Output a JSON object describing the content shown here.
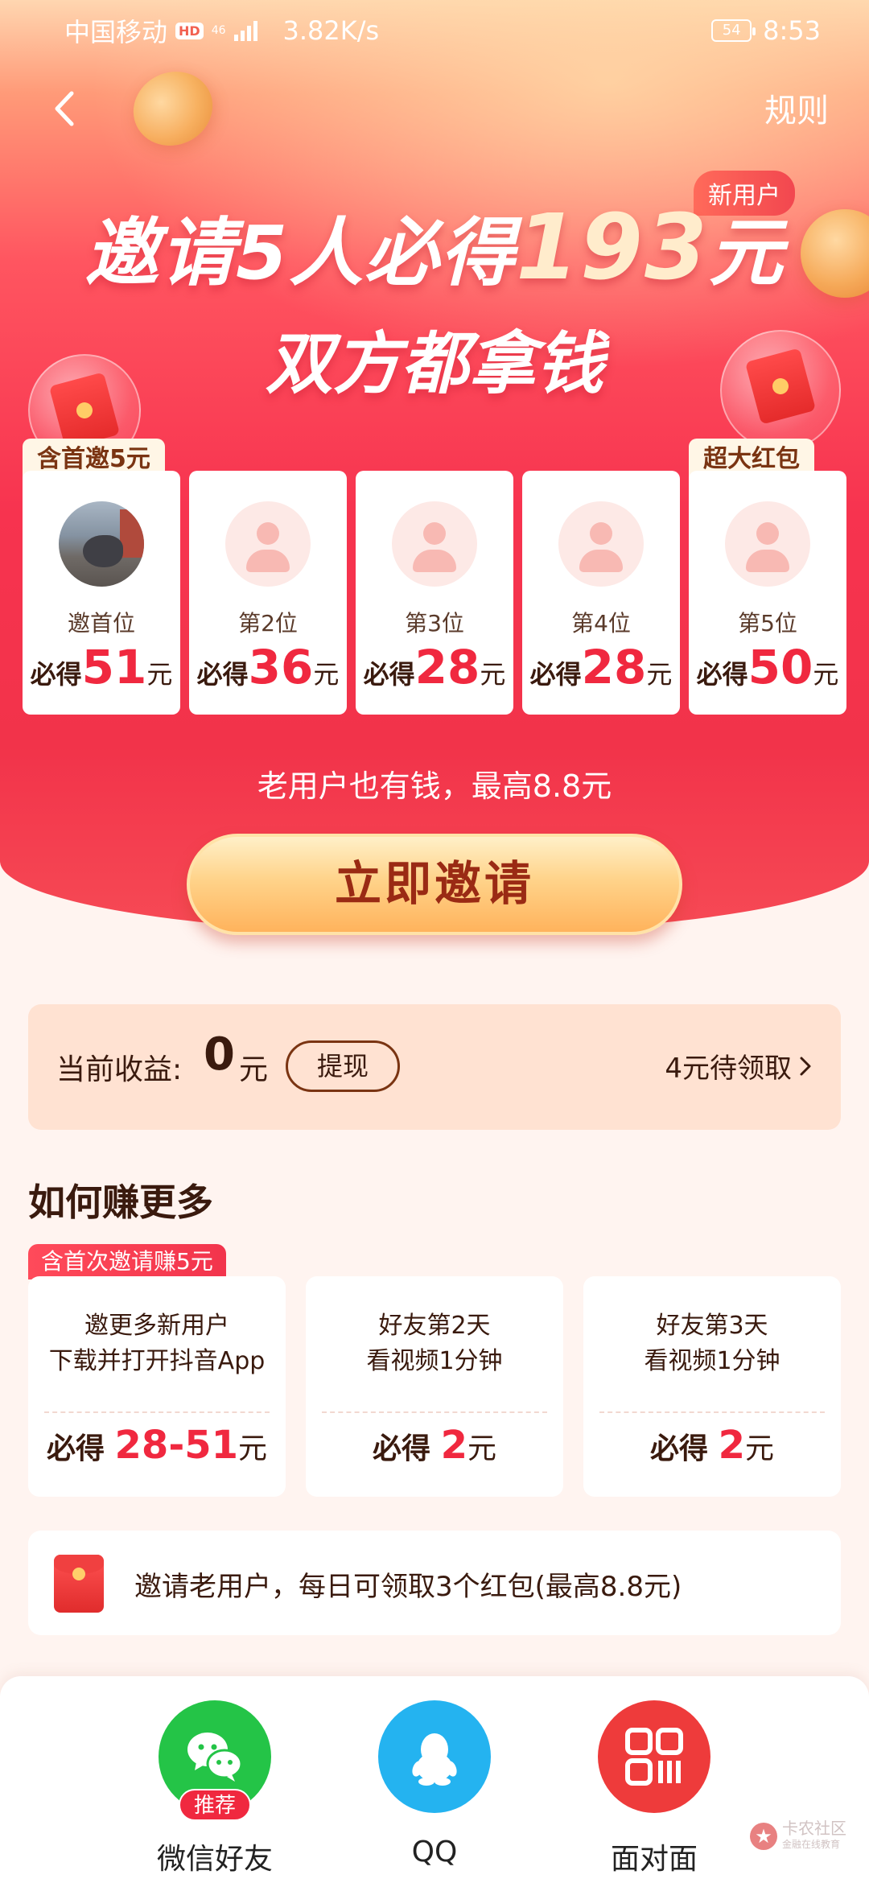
{
  "status_bar": {
    "carrier": "中国移动",
    "hd": "HD",
    "network": "46",
    "speed": "3.82K/s",
    "battery": "54",
    "time": "8:53"
  },
  "header": {
    "rules": "规则"
  },
  "hero": {
    "new_user_tag": "新用户",
    "headline_prefix": "邀请5人必得",
    "headline_amount": "193",
    "headline_suffix": "元",
    "subhead": "双方都拿钱"
  },
  "reward_cards": [
    {
      "tag": "含首邀5元",
      "position": "邀首位",
      "prefix": "必得",
      "amount": "51",
      "unit": "元"
    },
    {
      "tag": "",
      "position": "第2位",
      "prefix": "必得",
      "amount": "36",
      "unit": "元"
    },
    {
      "tag": "",
      "position": "第3位",
      "prefix": "必得",
      "amount": "28",
      "unit": "元"
    },
    {
      "tag": "",
      "position": "第4位",
      "prefix": "必得",
      "amount": "28",
      "unit": "元"
    },
    {
      "tag": "超大红包",
      "position": "第5位",
      "prefix": "必得",
      "amount": "50",
      "unit": "元"
    }
  ],
  "old_user_text": "老用户也有钱，最高8.8元",
  "invite_button": "立即邀请",
  "earnings": {
    "label": "当前收益:",
    "value": "0",
    "unit": "元",
    "withdraw": "提现",
    "pending": "4元待领取"
  },
  "earn_more": {
    "title": "如何赚更多",
    "tag": "含首次邀请赚5元",
    "cards": [
      {
        "line1": "邀更多新用户",
        "line2": "下载并打开抖音App",
        "prefix": "必得",
        "amount": "28-51",
        "unit": "元"
      },
      {
        "line1": "好友第2天",
        "line2": "看视频1分钟",
        "prefix": "必得",
        "amount": "2",
        "unit": "元"
      },
      {
        "line1": "好友第3天",
        "line2": "看视频1分钟",
        "prefix": "必得",
        "amount": "2",
        "unit": "元"
      }
    ]
  },
  "old_user_bar": "邀请老用户，每日可领取3个红包(最高8.8元)",
  "share": {
    "wechat_label": "微信好友",
    "wechat_badge": "推荐",
    "qq_label": "QQ",
    "f2f_label": "面对面"
  },
  "watermark": {
    "name": "卡农社区",
    "sub": "金融在线教育"
  },
  "colors": {
    "accent_red": "#f0283f",
    "brown_text": "#3a1a0e",
    "wechat_green": "#24c447",
    "qq_blue": "#24b3f0",
    "f2f_red": "#ee3b3b"
  }
}
